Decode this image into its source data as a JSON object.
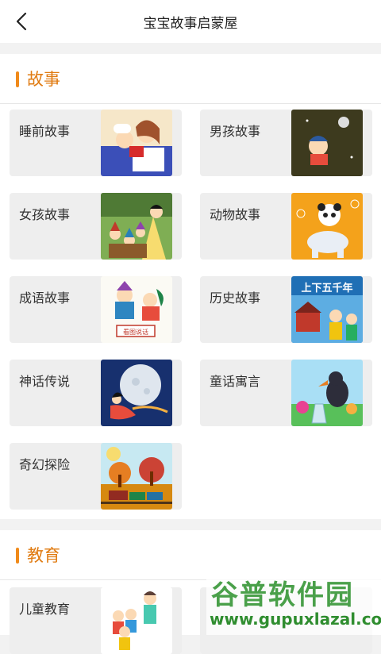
{
  "header": {
    "title": "宝宝故事启蒙屋",
    "back_icon": "back-chevron-icon"
  },
  "sections": [
    {
      "title": "故事",
      "cards": [
        {
          "label": "睡前故事",
          "image": "bedtime-story-illustration"
        },
        {
          "label": "男孩故事",
          "image": "boy-on-moon-illustration"
        },
        {
          "label": "女孩故事",
          "image": "snow-white-dwarfs-illustration"
        },
        {
          "label": "动物故事",
          "image": "panda-elephant-illustration"
        },
        {
          "label": "成语故事",
          "image": "idiom-story-illustration",
          "caption": "看图说话"
        },
        {
          "label": "历史故事",
          "image": "history-illustration",
          "caption": "上下五千年"
        },
        {
          "label": "神话传说",
          "image": "goddess-moon-illustration"
        },
        {
          "label": "童话寓言",
          "image": "crow-and-pitcher-illustration"
        },
        {
          "label": "奇幻探险",
          "image": "autumn-train-illustration"
        }
      ]
    },
    {
      "title": "教育",
      "cards": [
        {
          "label": "儿童教育",
          "image": "children-education-illustration"
        }
      ]
    }
  ],
  "watermark": {
    "logo": "谷普软件园",
    "url": "www.gupuxlazal.com"
  },
  "colors": {
    "accent": "#f08a1a",
    "card_bg": "#eeeeee",
    "page_bg": "#f2f2f2"
  }
}
